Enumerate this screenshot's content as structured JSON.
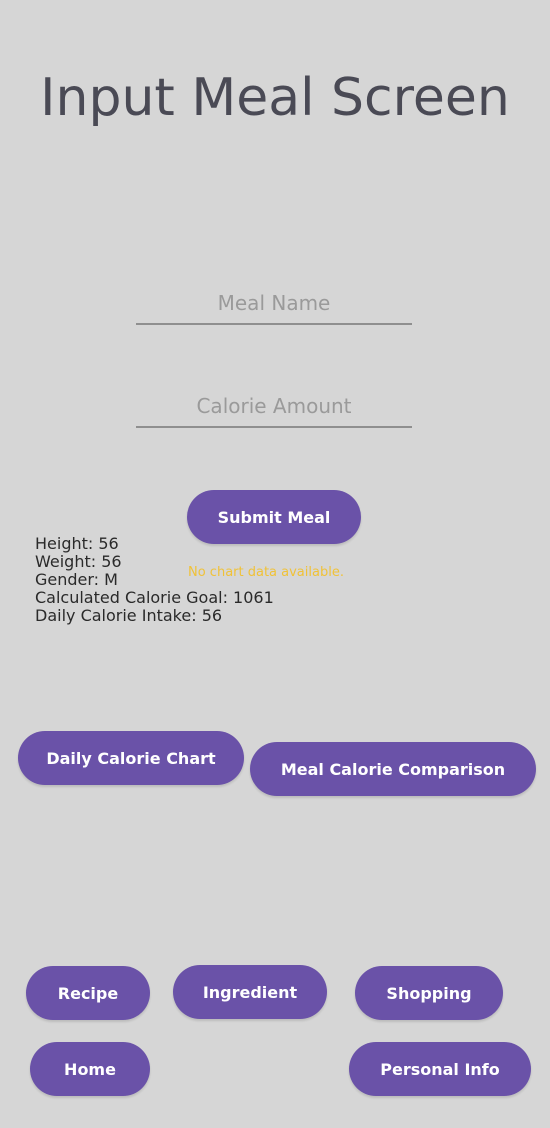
{
  "screen": {
    "title": "Input Meal Screen"
  },
  "form": {
    "meal_name_placeholder": "Meal Name",
    "calorie_amount_placeholder": "Calorie Amount",
    "submit_label": "Submit Meal"
  },
  "stats": {
    "height": "Height: 56",
    "weight": "Weight: 56",
    "gender": "Gender: M",
    "calorie_goal": "Calculated Calorie Goal: 1061",
    "daily_intake": "Daily Calorie Intake: 56"
  },
  "chart_message": "No chart data available.",
  "chart_buttons": {
    "daily_chart": "Daily Calorie Chart",
    "meal_comparison": "Meal Calorie Comparison"
  },
  "nav": {
    "recipe": "Recipe",
    "ingredient": "Ingredient",
    "shopping": "Shopping",
    "home": "Home",
    "personal_info": "Personal Info"
  },
  "colors": {
    "background": "#d6d6d6",
    "accent": "#6a52a8",
    "warning_text": "#f0c238"
  }
}
